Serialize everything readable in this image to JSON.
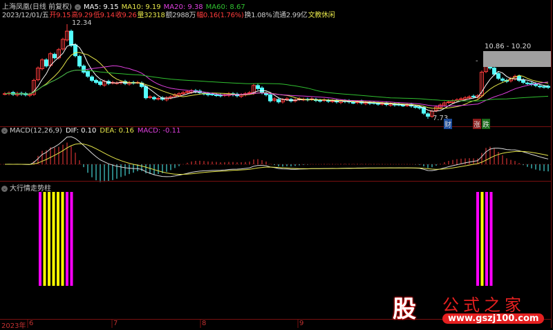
{
  "header": {
    "stock": "上海凤凰(日线 前复权)",
    "ma5": "MA5: 9.15",
    "ma10": "MA10: 9.19",
    "ma20": "MA20: 9.38",
    "ma60": "MA60: 8.67",
    "date": "2023/12/01/五",
    "open": "开9.15",
    "high": "高9.29",
    "low": "低9.14",
    "close": "收9.26",
    "vol": "量32318",
    "amount": "额2988万",
    "change": "幅0.16(1.76%)",
    "turnover": "换1.08%",
    "float": "流通2.99亿",
    "sector": "文教休闲"
  },
  "main": {
    "high_label": "12.34",
    "low_label": "7.73",
    "range_label": "10.86 - 10.20",
    "tag_cai": "财",
    "tag_zhang": "涨",
    "tag_die": "跌"
  },
  "macd": {
    "title": "MACD(12,26,9)",
    "dif": "DIF: 0.10",
    "dea": "DEA: 0.16",
    "macd": "MACD: -0.11"
  },
  "indicator": {
    "title": "大行情走势柱",
    "left_bars": [
      "#ff00ff",
      "#ffff00",
      "#ffff00",
      "#ffff00",
      "#ffff00",
      "#ffff00",
      "#ff00ff",
      "#ff00ff"
    ],
    "right_bars": [
      "#ff00ff",
      "#ffff00",
      "#ff00ff",
      "#ff00ff"
    ]
  },
  "axis": {
    "year": "2023年",
    "months": [
      "6",
      "7",
      "8",
      "9"
    ]
  },
  "watermark": {
    "logo": "股",
    "name": "公式之家",
    "url": "www.gszj100.com"
  },
  "colors": {
    "up": "#ff3c3c",
    "down": "#54ffff",
    "ma5": "#ffffff",
    "ma10": "#e6e64a",
    "ma20": "#e040e0",
    "ma60": "#30c030"
  },
  "chart_data": {
    "type": "candlestick",
    "price_range": [
      7.73,
      12.34
    ],
    "closes": [
      8.95,
      8.98,
      8.92,
      8.97,
      8.93,
      8.9,
      8.92,
      9.6,
      10.2,
      10.6,
      10.3,
      10.9,
      10.7,
      11.1,
      11.6,
      12.0,
      11.3,
      10.8,
      10.3,
      10.0,
      9.8,
      9.6,
      9.5,
      9.4,
      9.55,
      9.45,
      9.5,
      9.48,
      9.52,
      9.45,
      9.5,
      9.47,
      9.5,
      9.3,
      8.75,
      8.8,
      8.7,
      8.72,
      8.68,
      8.75,
      8.8,
      8.9,
      8.95,
      9.0,
      9.05,
      9.1,
      9.05,
      9.0,
      8.95,
      8.9,
      8.92,
      8.88,
      8.85,
      8.9,
      8.95,
      8.9,
      8.85,
      8.9,
      8.95,
      9.0,
      9.35,
      9.2,
      9.0,
      8.9,
      8.6,
      8.7,
      8.55,
      8.65,
      8.7,
      8.6,
      8.65,
      8.7,
      8.68,
      8.65,
      8.7,
      8.62,
      8.6,
      8.65,
      8.58,
      8.6,
      8.55,
      8.6,
      8.57,
      8.55,
      8.52,
      8.55,
      8.5,
      8.52,
      8.48,
      8.5,
      8.45,
      8.47,
      8.42,
      8.45,
      8.4,
      8.42,
      8.38,
      8.4,
      8.35,
      8.3,
      8.25,
      8.0,
      7.85,
      8.1,
      8.3,
      8.4,
      8.5,
      8.55,
      8.6,
      8.65,
      8.7,
      8.75,
      8.8,
      8.8,
      8.85,
      10.0,
      10.4,
      10.2,
      9.9,
      9.7,
      9.6,
      9.55,
      9.7,
      9.8,
      9.6,
      9.5,
      9.45,
      9.4,
      9.35,
      9.3,
      9.28,
      9.26
    ]
  }
}
